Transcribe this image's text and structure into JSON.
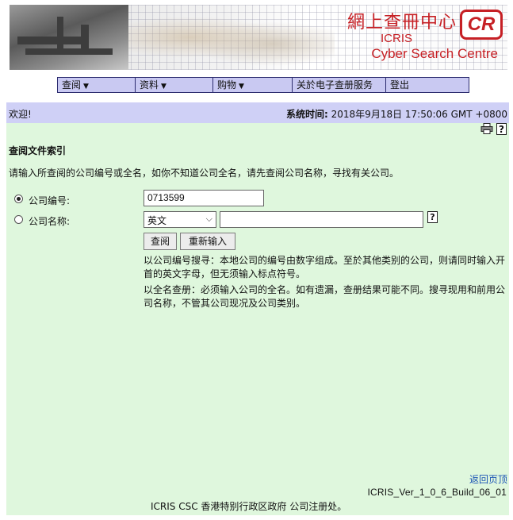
{
  "banner": {
    "title_cn": "網上查冊中心",
    "title_en": "ICRIS",
    "subtitle": "Cyber Search Centre",
    "logo_text": "CR"
  },
  "menu": {
    "items": [
      {
        "label": "查阅",
        "has_caret": true
      },
      {
        "label": "资料",
        "has_caret": true
      },
      {
        "label": "购物",
        "has_caret": true
      },
      {
        "label": "关於电子查册服务",
        "has_caret": false
      },
      {
        "label": "登出",
        "has_caret": false
      }
    ],
    "caret_glyph": "▼"
  },
  "welcome_bar": {
    "welcome": "欢迎!",
    "time_label": "系统时间:",
    "time_value": "2018年9月18日 17:50:06 GMT +0800"
  },
  "tools": {
    "print_icon": "printer-icon",
    "help_icon": "help-icon",
    "help_glyph": "?"
  },
  "form": {
    "heading": "查阅文件索引",
    "instruction": "请输入所查阅的公司编号或全名，如你不知道公司全名，请先查阅公司名称，寻找有关公司。",
    "company_number_label": "公司编号:",
    "company_number_value": "0713599",
    "company_name_label": "公司名称:",
    "language_selected": "英文",
    "company_name_value": "",
    "search_button": "查阅",
    "reset_button": "重新输入",
    "note1": "以公司编号搜寻：本地公司的编号由数字组成。至於其他类别的公司，则请同时输入开首的英文字母，但无须输入标点符号。",
    "note2": "以全名查册：必须输入公司的全名。如有遗漏，查册结果可能不同。搜寻现用和前用公司名称，不管其公司现况及公司类别。"
  },
  "footer": {
    "back_link": "返回页顶",
    "build": "ICRIS_Ver_1_0_6_Build_06_01",
    "org": "ICRIS CSC 香港特别行政区政府 公司注册处。"
  },
  "colors": {
    "panel_bg": "#dff7dd",
    "header_bar_bg": "#cfd0f6",
    "menu_bg": "#c9c9f2",
    "brand_red": "#c62025",
    "link": "#1c55b5"
  }
}
